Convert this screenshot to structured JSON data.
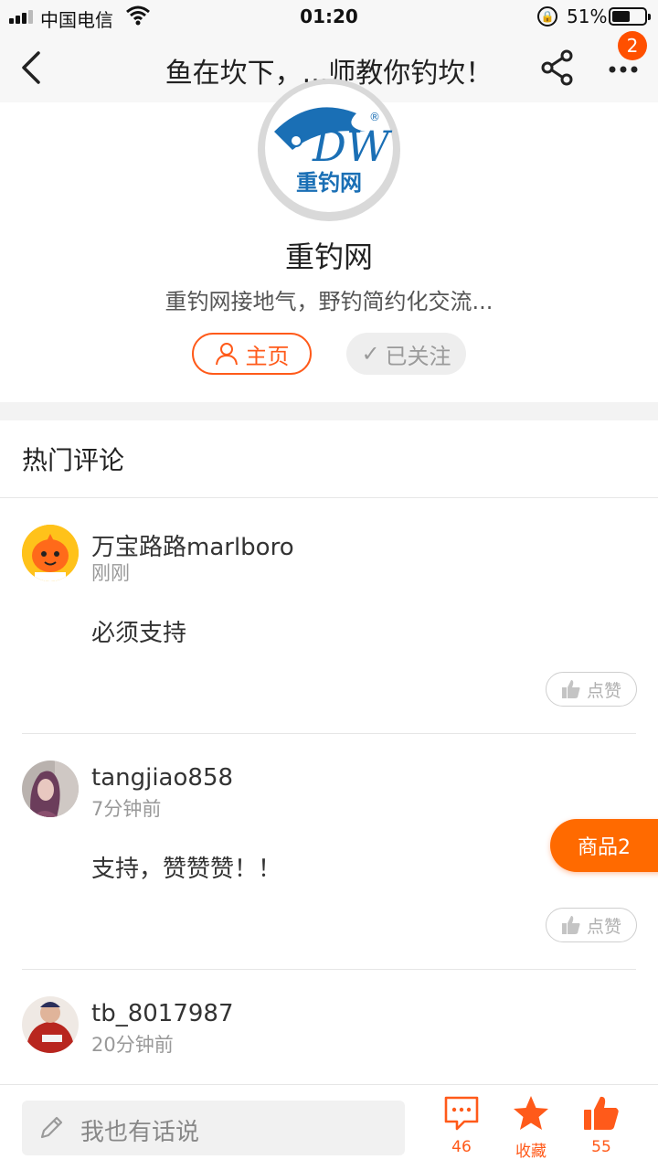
{
  "status_bar": {
    "carrier": "中国电信",
    "time": "01:20",
    "battery": "51%",
    "battery_level": 0.51
  },
  "nav": {
    "title": "鱼在坎下，...师教你钓坎！",
    "badge_count": "2"
  },
  "profile": {
    "logo_text": "重钓网",
    "name": "重钓网",
    "description": "重钓网接地气，野钓简约化交流...",
    "home_label": "主页",
    "follow_label": "已关注"
  },
  "hot_comments": {
    "title": "热门评论",
    "items": [
      {
        "user": "万宝路路marlboro",
        "time": "刚刚",
        "text": "必须支持",
        "like_label": "点赞"
      },
      {
        "user": "tangjiao858",
        "time": "7分钟前",
        "text": "支持，赞赞赞！！",
        "like_label": "点赞"
      },
      {
        "user": "tb_8017987",
        "time": "20分钟前"
      }
    ]
  },
  "floating": {
    "goods_label": "商品2"
  },
  "bottom_bar": {
    "input_placeholder": "我也有话说",
    "comments_count": "46",
    "favorite_label": "收藏",
    "likes_count": "55"
  },
  "colors": {
    "accent": "#ff5a1a",
    "goods_button": "#ff6a00",
    "logo_blue": "#1a6fb5"
  }
}
